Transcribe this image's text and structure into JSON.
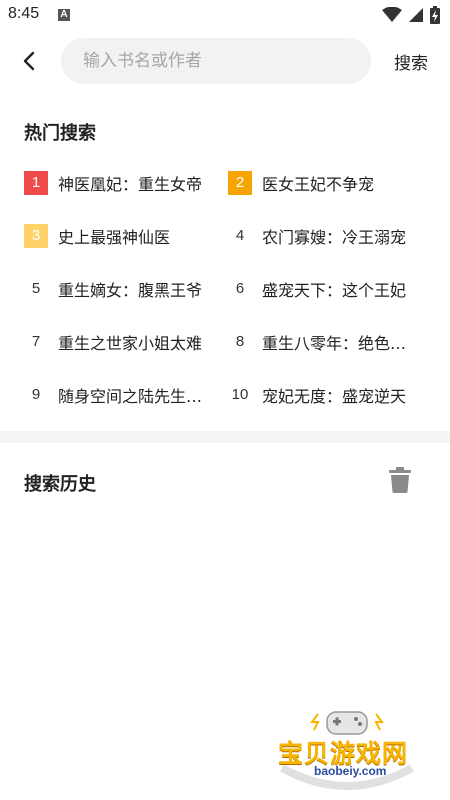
{
  "status_bar": {
    "time": "8:45",
    "notification_glyph": "A"
  },
  "header": {
    "search_placeholder": "输入书名或作者",
    "search_value": "",
    "search_button": "搜索"
  },
  "hot": {
    "title": "热门搜索",
    "items": [
      {
        "rank": "1",
        "label": "神医凰妃：重生女帝"
      },
      {
        "rank": "2",
        "label": "医女王妃不争宠"
      },
      {
        "rank": "3",
        "label": "史上最强神仙医"
      },
      {
        "rank": "4",
        "label": "农门寡嫂：冷王溺宠"
      },
      {
        "rank": "5",
        "label": "重生嫡女：腹黑王爷"
      },
      {
        "rank": "6",
        "label": "盛宠天下：这个王妃"
      },
      {
        "rank": "7",
        "label": "重生之世家小姐太难"
      },
      {
        "rank": "8",
        "label": "重生八零年：绝色娇妻"
      },
      {
        "rank": "9",
        "label": "随身空间之陆先生宠妻"
      },
      {
        "rank": "10",
        "label": "宠妃无度：盛宠逆天"
      }
    ]
  },
  "history": {
    "title": "搜索历史"
  },
  "watermark": {
    "name": "宝贝游戏网",
    "url": "baobeiy.com"
  },
  "colors": {
    "rank1": "#ef4b4b",
    "rank2": "#f6a400",
    "rank3": "#ffd36a"
  }
}
